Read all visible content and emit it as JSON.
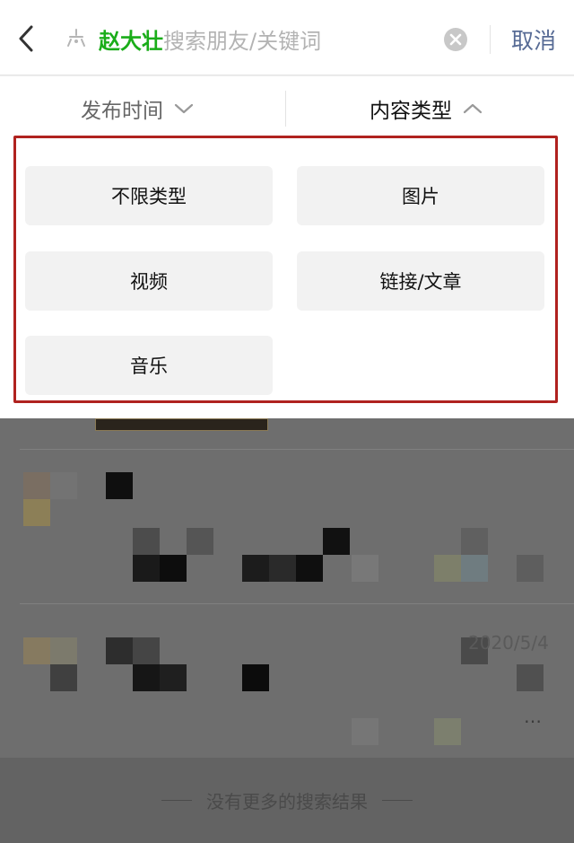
{
  "search": {
    "tag": "赵大壮",
    "placeholder": "搜索朋友/关键词",
    "cancel_label": "取消"
  },
  "filters": {
    "publish_time_label": "发布时间",
    "content_type_label": "内容类型"
  },
  "content_types": [
    "不限类型",
    "图片",
    "视频",
    "链接/文章",
    "音乐"
  ],
  "results": {
    "date": "2020/5/4",
    "more": "…",
    "footer_text": "没有更多的搜索结果"
  },
  "colors": {
    "accent_green": "#1aad19",
    "link_blue": "#576b95",
    "highlight_red": "#b0221f"
  },
  "icons": {
    "back": "chevron-left-icon",
    "star": "star-icon",
    "clear": "clear-circle-x-icon",
    "publish_time_chevron": "chevron-down-icon",
    "content_type_chevron": "chevron-up-icon"
  }
}
